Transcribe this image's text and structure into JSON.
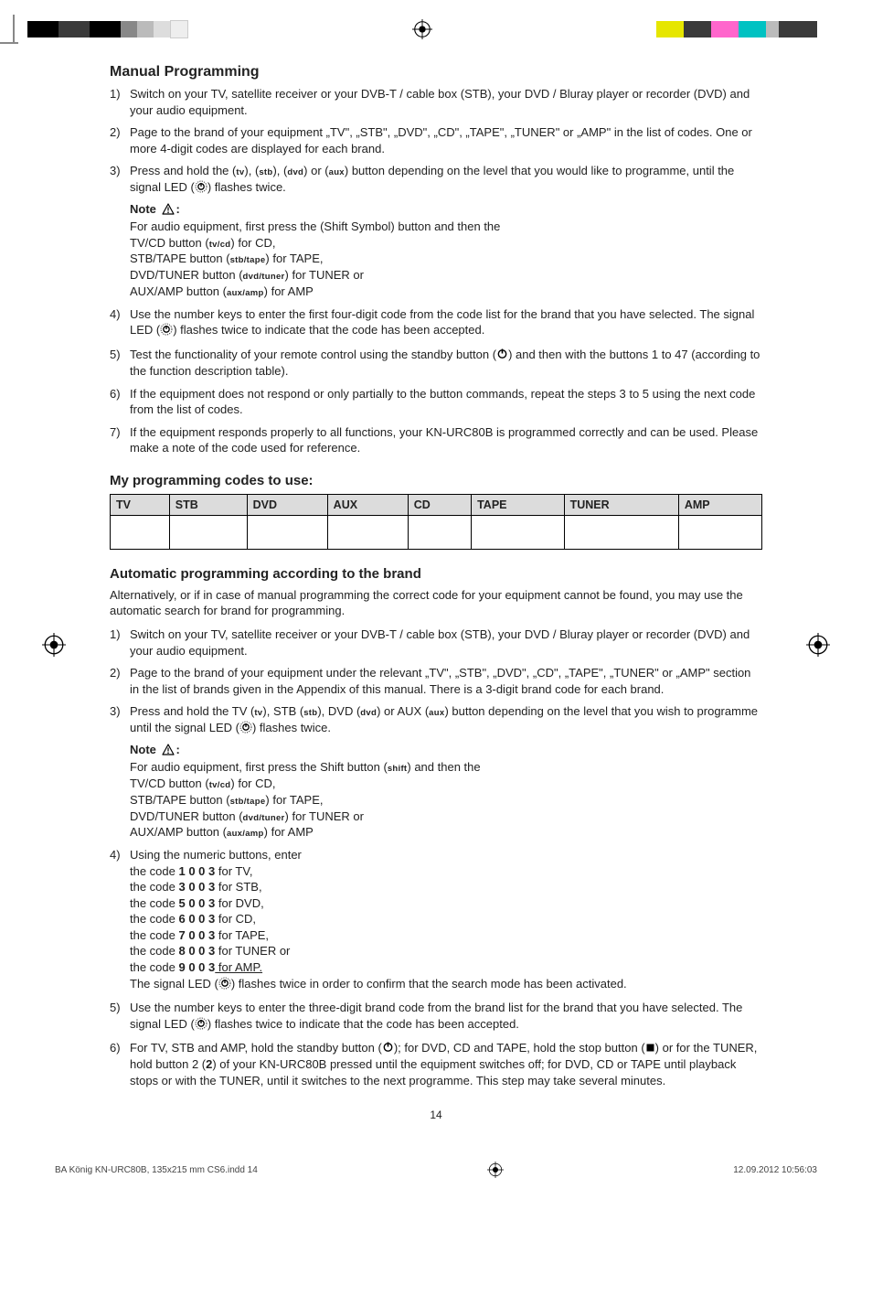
{
  "section_manual_title": "Manual Programming",
  "manual_steps": [
    {
      "num": "1)",
      "text": "Switch on your TV, satellite receiver or your DVB-T / cable box (STB), your DVD / Bluray player or recorder (DVD) and your audio equipment."
    },
    {
      "num": "2)",
      "text": "Page to the brand of your equipment „TV\", „STB\", „DVD\", „CD\", „TAPE\", „TUNER\" or „AMP\" in the list of codes. One or more 4-digit codes are displayed for each brand."
    }
  ],
  "manual_step3_num": "3)",
  "manual_step3_line1a": "Press and hold the (",
  "manual_step3_btn_tv": "tv",
  "manual_step3_line1b": "), (",
  "manual_step3_btn_stb": "stb",
  "manual_step3_line1c": "), (",
  "manual_step3_btn_dvd": "dvd",
  "manual_step3_line1d": ") or (",
  "manual_step3_btn_aux": "aux",
  "manual_step3_line1e": ") button depending on the level that you would like to programme, until the signal LED (",
  "manual_step3_line1f": ") flashes twice.",
  "note_label": "Note ",
  "note_colon": ":",
  "note_line1": "For audio equipment, first press the (Shift Symbol) button and then the",
  "note_tvcd_a": "TV/CD button (",
  "note_tvcd_btn": "tv/cd",
  "note_tvcd_b": ") for CD,",
  "note_stbtape_a": "STB/TAPE button (",
  "note_stbtape_btn": "stb/tape",
  "note_stbtape_b": ") for TAPE,",
  "note_dvdtuner_a": "DVD/TUNER button (",
  "note_dvdtuner_btn": "dvd/tuner",
  "note_dvdtuner_b": ") for TUNER or",
  "note_auxamp_a": "AUX/AMP button (",
  "note_auxamp_btn": "aux/amp",
  "note_auxamp_b": ") for AMP",
  "manual_step4_num": "4)",
  "manual_step4_a": "Use the number keys to enter the first four-digit code from the code list for the brand that you have selected. The signal LED (",
  "manual_step4_b": ") flashes twice to indicate that the code has been accepted.",
  "manual_step5_num": "5)",
  "manual_step5_a": "Test the functionality of your remote control using the standby button (",
  "manual_step5_b": ") and then with the buttons 1 to 47 (according to the function description table).",
  "manual_step6": {
    "num": "6)",
    "text": "If the equipment does not respond or only partially to the button commands, repeat the steps 3 to 5 using the next code from the list of codes."
  },
  "manual_step7": {
    "num": "7)",
    "text": "If the equipment responds properly to all functions, your KN-URC80B is programmed correctly and can be used. Please make a note of the code used for reference."
  },
  "mycodes_title": "My programming codes to use:",
  "table_headers": [
    "TV",
    "STB",
    "DVD",
    "AUX",
    "CD",
    "TAPE",
    "TUNER",
    "AMP"
  ],
  "auto_title": "Automatic programming according to the brand",
  "auto_intro": "Alternatively, or if in case of manual programming the correct code for your equipment cannot be found, you may use the automatic search for brand for programming.",
  "auto_step1": {
    "num": "1)",
    "text": "Switch on your TV, satellite receiver or your DVB-T / cable box (STB), your DVD / Bluray player or recorder (DVD) and your audio equipment."
  },
  "auto_step2": {
    "num": "2)",
    "text": "Page to the brand of your equipment under the relevant „TV\", „STB\", „DVD\", „CD\", „TAPE\", „TUNER\" or „AMP\" section in the list of brands given in the Appendix of this manual. There is a 3-digit brand code for each brand."
  },
  "auto_step3_num": "3)",
  "auto_step3_a": "Press and hold the TV (",
  "auto_step3_tv": "tv",
  "auto_step3_b": "), STB (",
  "auto_step3_stb": "stb",
  "auto_step3_c": "), DVD (",
  "auto_step3_dvd": "dvd",
  "auto_step3_d": ") or AUX (",
  "auto_step3_aux": "aux",
  "auto_step3_e": ") button depending on the level that you wish to programme until the signal LED (",
  "auto_step3_f": ") flashes twice.",
  "auto_note_line1_a": "For audio equipment, first press the Shift button (",
  "auto_note_shift": "shift",
  "auto_note_line1_b": ") and then the",
  "auto_step4_num": "4)",
  "auto_step4_intro": "Using the numeric buttons, enter",
  "auto_codes": [
    {
      "pre": "the code ",
      "code": "1 0 0 3",
      "post": " for TV,"
    },
    {
      "pre": "the code ",
      "code": "3 0 0 3",
      "post": " for STB,"
    },
    {
      "pre": "the code ",
      "code": "5 0 0 3",
      "post": " for DVD,"
    },
    {
      "pre": "the code ",
      "code": "6 0 0 3",
      "post": " for CD,"
    },
    {
      "pre": "the code ",
      "code": "7 0 0 3",
      "post": " for TAPE,"
    },
    {
      "pre": "the code ",
      "code": "8 0 0 3",
      "post": " for TUNER or"
    },
    {
      "pre": "the code ",
      "code": "9 0 0 3",
      "post": " for AMP."
    }
  ],
  "auto_step4_end_a": "The signal LED (",
  "auto_step4_end_b": ") flashes twice in order to confirm that the search mode has been activated.",
  "auto_step5_num": "5)",
  "auto_step5_a": "Use the number keys to enter the three-digit brand code from the brand list for the brand that you have selected. The signal LED (",
  "auto_step5_b": ") flashes twice to indicate that the code has been accepted.",
  "auto_step6_num": "6)",
  "auto_step6_a": "For TV, STB and AMP, hold the standby button (",
  "auto_step6_b": "); for DVD, CD and TAPE, hold the stop button (",
  "auto_step6_c": ") or for the TUNER, hold button 2 (",
  "auto_step6_two": "2",
  "auto_step6_d": ") of your KN-URC80B pressed until the equipment switches off; for DVD, CD or TAPE until playback stops or with the TUNER, until it switches to the next programme. This step may take several minutes.",
  "page_number": "14",
  "footer_left": "BA König KN-URC80B, 135x215 mm CS6.indd   14",
  "footer_right": "12.09.2012   10:56:03"
}
